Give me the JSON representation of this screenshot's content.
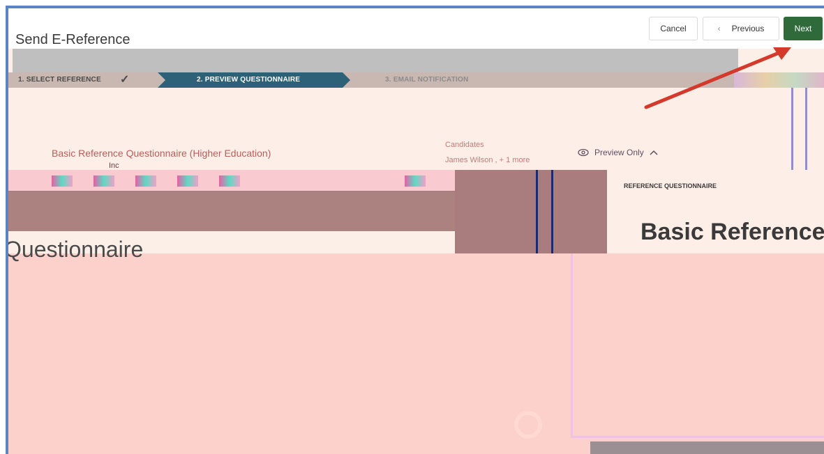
{
  "header": {
    "title": "Send E-Reference",
    "cancel_label": "Cancel",
    "previous_label": "Previous",
    "previous_icon": "chevron-left-icon",
    "next_label": "Next",
    "next_color": "#2e6a3a"
  },
  "steps": [
    {
      "label": "1. SELECT REFERENCE",
      "state": "complete"
    },
    {
      "label": "2. PREVIEW QUESTIONNAIRE",
      "state": "active"
    },
    {
      "label": "3. EMAIL NOTIFICATION",
      "state": "pending"
    }
  ],
  "step_check_icon": "checkmark-icon",
  "card": {
    "questionnaire_title": "Basic Reference Questionnaire (Higher Education)",
    "questionnaire_sub": "Inc",
    "candidates_label": "Candidates",
    "candidates_value": "James Wilson , + 1 more",
    "preview_label": "Preview Only",
    "preview_icon": "eye-icon",
    "toggle_icon": "chevron-up-icon"
  },
  "preview_pane": {
    "section_label": "REFERENCE QUESTIONNAIRE",
    "title_partial": "Basic Reference",
    "body_partial": "Questionnaire"
  },
  "colors": {
    "active_step": "#2d6178",
    "annotation_arrow": "#d33a2c",
    "frame": "#5b84c4"
  }
}
